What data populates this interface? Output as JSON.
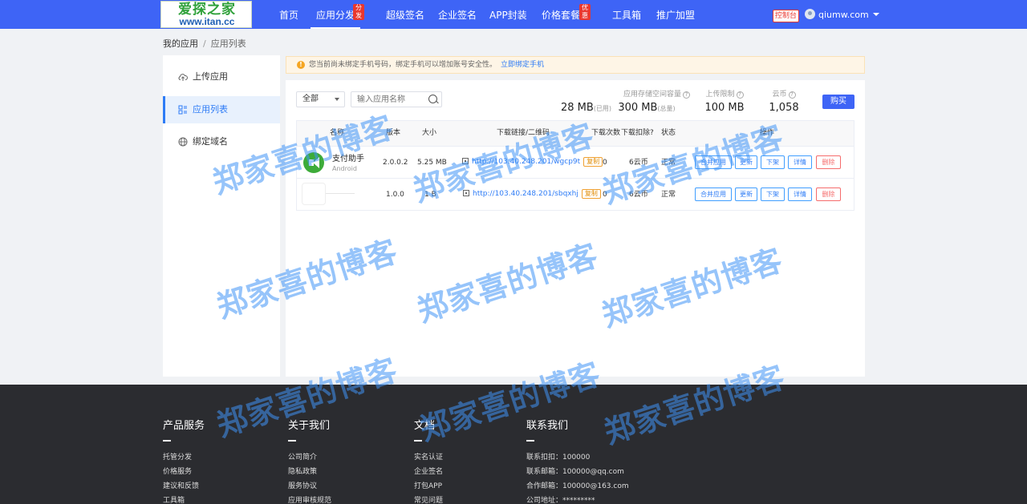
{
  "logo": {
    "line1": "爱探之家",
    "line2": "www.itan.cc"
  },
  "nav": {
    "items": [
      {
        "label": "首页"
      },
      {
        "label": "应用分发",
        "badge": "分发",
        "active": true
      },
      {
        "label": "超级签名"
      },
      {
        "label": "企业签名"
      },
      {
        "label": "APP封装"
      },
      {
        "label": "价格套餐",
        "badge": "优惠"
      },
      {
        "label": "工具箱"
      },
      {
        "label": "推广加盟"
      }
    ],
    "console_label": "控制台",
    "user_name": "qiumw.com"
  },
  "breadcrumb": {
    "root": "我的应用",
    "sep": "/",
    "current": "应用列表"
  },
  "sidebar": {
    "items": [
      {
        "label": "上传应用",
        "icon": "cloud-upload-icon"
      },
      {
        "label": "应用列表",
        "icon": "grid-list-icon",
        "active": true
      },
      {
        "label": "绑定域名",
        "icon": "globe-icon"
      }
    ]
  },
  "notice": {
    "text": "您当前尚未绑定手机号码，绑定手机可以增加账号安全性。",
    "link": "立即绑定手机"
  },
  "toolbar": {
    "filter_value": "全部",
    "search_placeholder": "输入应用名称",
    "buy_label": "购买"
  },
  "stats": {
    "storage_label": "应用存储空间容量",
    "used": "28 MB",
    "used_unit": "(已用)",
    "total": "300 MB",
    "total_unit": "(总量)",
    "upload_limit_label": "上传限制",
    "upload_limit": "100 MB",
    "coins_label": "云币",
    "coins": "1,058"
  },
  "table": {
    "headers": {
      "name": "名称",
      "version": "版本",
      "size": "大小",
      "link": "下载链接/二维码",
      "downloads": "下载次数",
      "deduct": "下载扣除?",
      "status": "状态",
      "ops": "操作"
    },
    "rows": [
      {
        "name": "支付助手",
        "platform": "Android",
        "version": "2.0.0.2",
        "size": "5.25 MB",
        "link": "http://103.40.248.201/wgcp9t",
        "copy": "复制",
        "downloads": "0",
        "deduct": "6云币",
        "status": "正常"
      },
      {
        "name": "",
        "platform": "",
        "version": "1.0.0",
        "size": "1 B",
        "link": "http://103.40.248.201/sbqxhj",
        "copy": "复制",
        "downloads": "0",
        "deduct": "6云币",
        "status": "正常"
      }
    ],
    "actions": {
      "merge": "合并应用",
      "update": "更新",
      "offline": "下架",
      "detail": "详情",
      "delete": "删除"
    }
  },
  "footer": {
    "products": {
      "title": "产品服务",
      "items": [
        "托管分发",
        "价格服务",
        "建议和反馈",
        "工具箱"
      ]
    },
    "about": {
      "title": "关于我们",
      "items": [
        "公司简介",
        "隐私政策",
        "服务协议",
        "应用审核规范"
      ]
    },
    "docs": {
      "title": "文档",
      "items": [
        "实名认证",
        "企业签名",
        "打包APP",
        "常见问题"
      ]
    },
    "contact": {
      "title": "联系我们",
      "items": [
        "联系扣扣：100000",
        "联系邮箱：100000@qq.com",
        "合作邮箱：100000@163.com",
        "公司地址：*********"
      ]
    }
  },
  "watermark": "郑家喜的博客",
  "colors": {
    "primary": "#3e64f6",
    "accent": "#2e7cf6",
    "danger": "#f56c6c",
    "footer_bg": "#2b2c30"
  }
}
